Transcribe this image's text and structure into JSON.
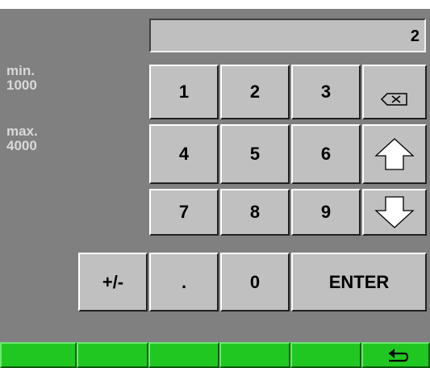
{
  "display": {
    "value": "2"
  },
  "limits": {
    "min_label": "min.",
    "min_value": "1000",
    "max_label": "max.",
    "max_value": "4000"
  },
  "keys": {
    "k1": "1",
    "k2": "2",
    "k3": "3",
    "k4": "4",
    "k5": "5",
    "k6": "6",
    "k7": "7",
    "k8": "8",
    "k9": "9",
    "sign": "+/-",
    "dot": ".",
    "k0": "0",
    "enter": "ENTER"
  },
  "icons": {
    "backspace": "backspace-icon",
    "up": "arrow-up-icon",
    "down": "arrow-down-icon",
    "back": "return-arrow-icon"
  },
  "colors": {
    "panel": "#808080",
    "key": "#c0c0c0",
    "function_bar": "#21c721"
  }
}
